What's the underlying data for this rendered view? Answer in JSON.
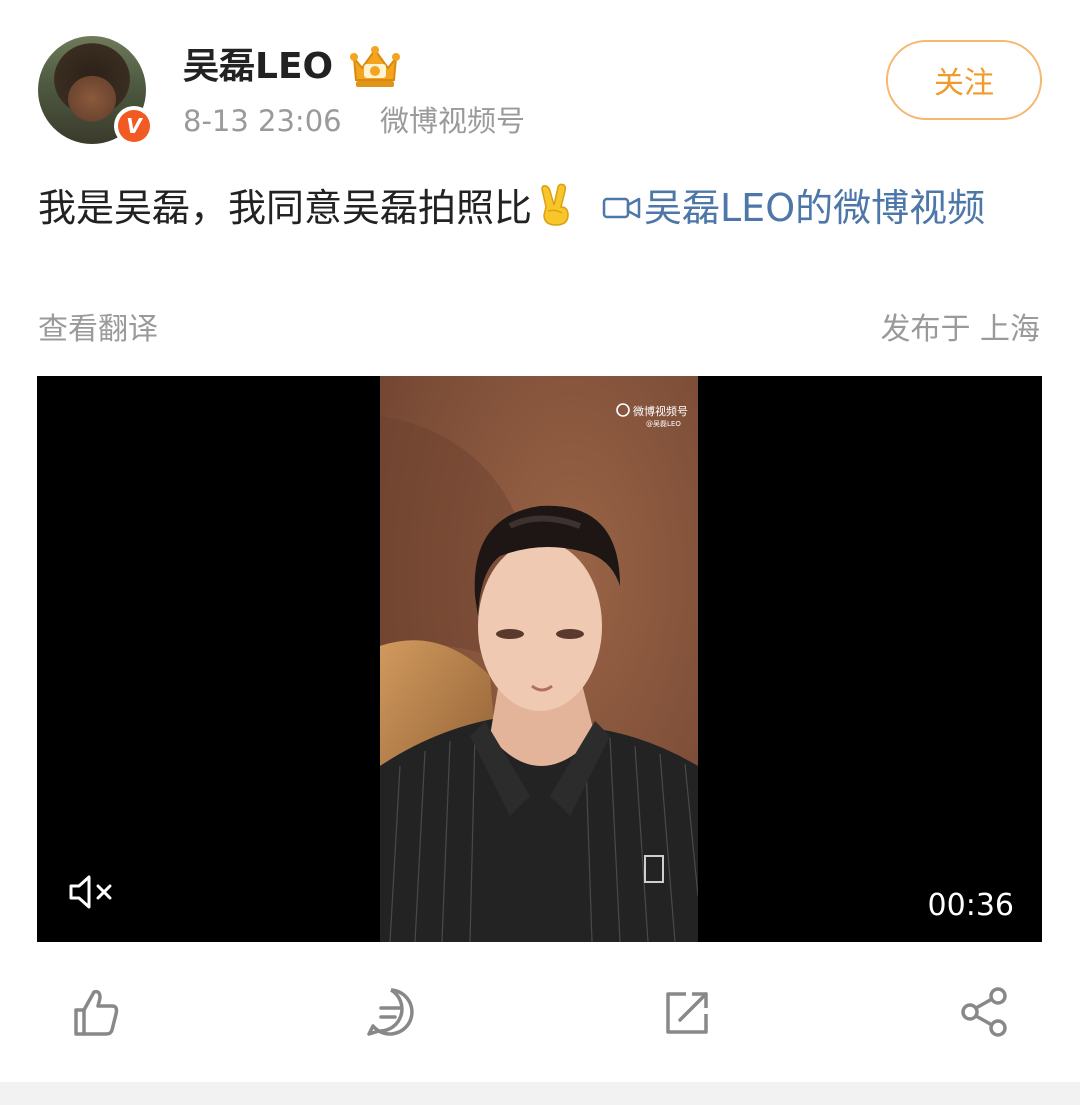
{
  "post": {
    "author": {
      "name": "吴磊LEO",
      "verified_badge": "V",
      "verified_color": "#f15a22"
    },
    "time": "8-13 23:06",
    "source": "微博视频号",
    "follow_label": "关注",
    "text": "我是吴磊，我同意吴磊拍照比",
    "emoji": "victory-hand",
    "video_link_label": "吴磊LEO的微博视频",
    "translate_label": "查看翻译",
    "location_label": "发布于 上海"
  },
  "video": {
    "watermark_text": "微博视频号",
    "watermark_sub": "@吴磊LEO",
    "duration": "00:36",
    "muted": true
  },
  "actions": {
    "icons": [
      "like-icon",
      "comment-icon",
      "repost-icon",
      "share-icon"
    ]
  },
  "colors": {
    "accent": "#f09a2a",
    "link": "#4d77a8",
    "meta": "#9a9a9a"
  }
}
